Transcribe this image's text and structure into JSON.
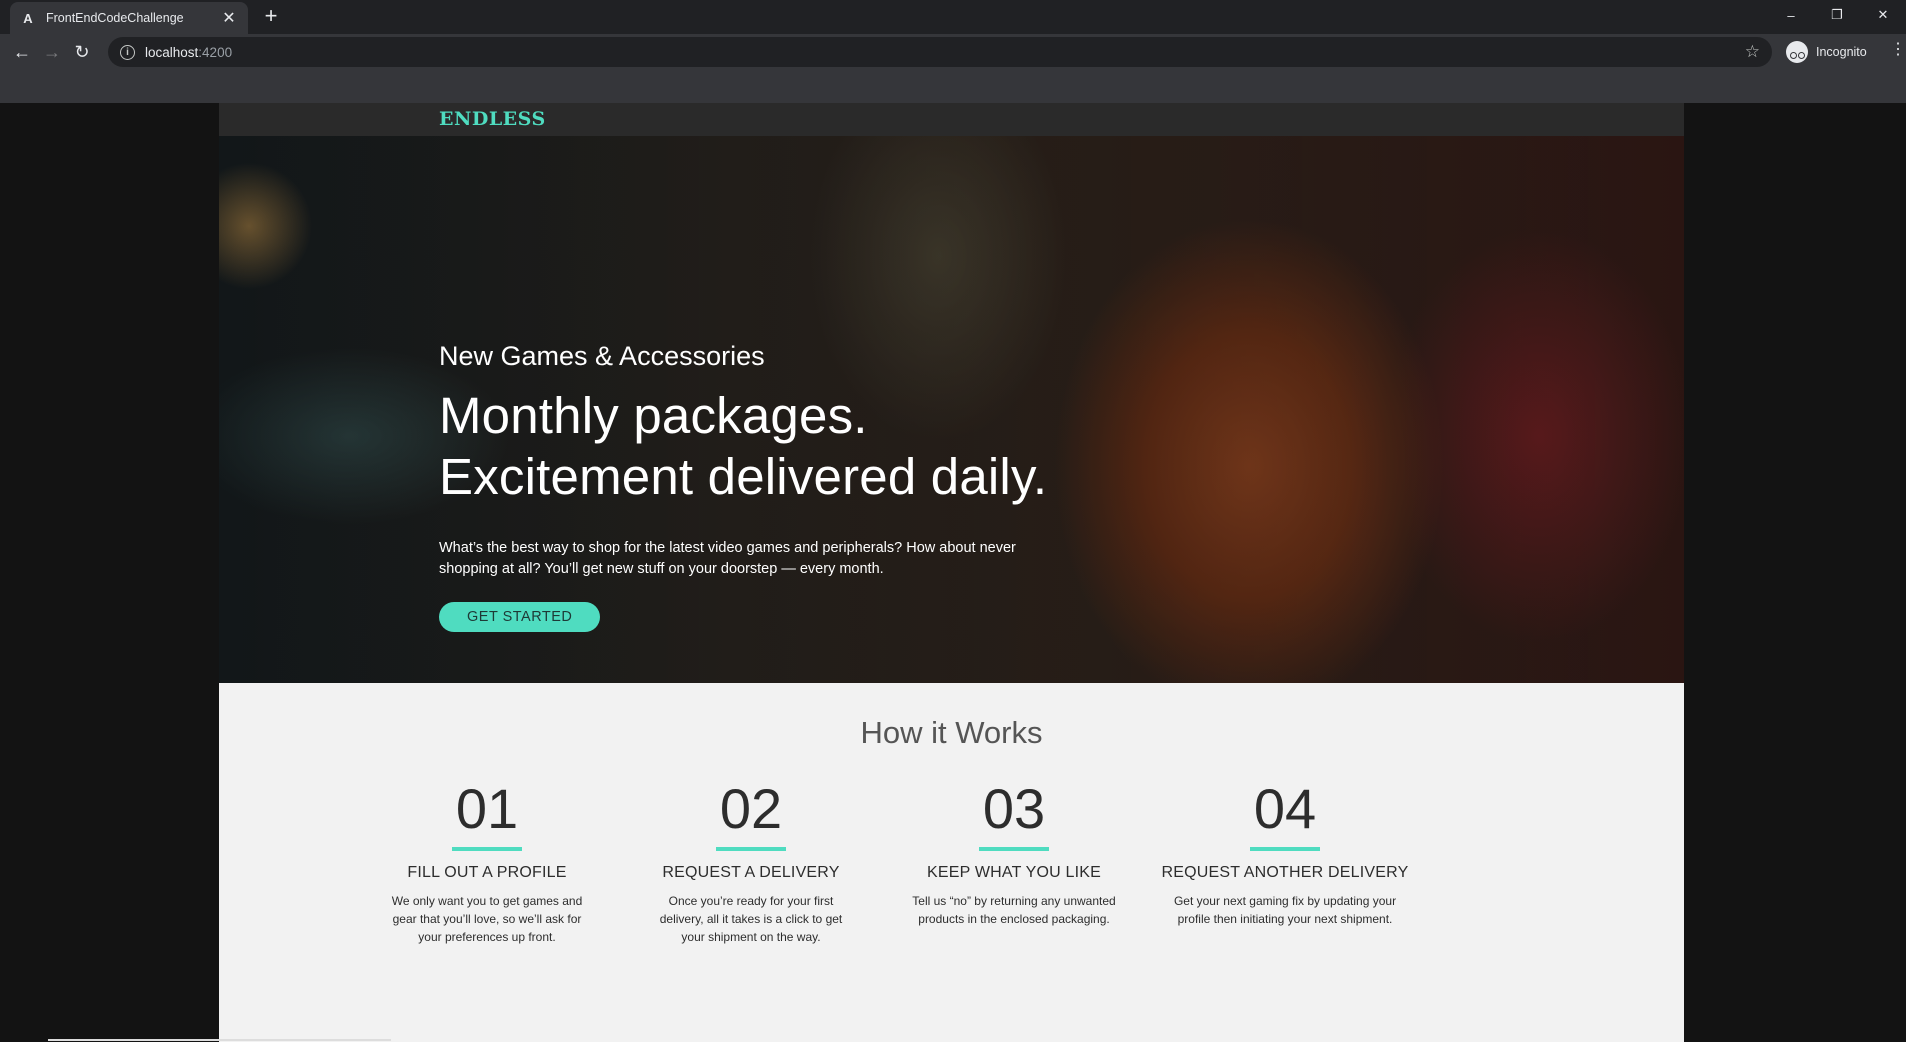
{
  "browser": {
    "tab_title": "FrontEndCodeChallenge",
    "tab_favicon": "A",
    "tab_close": "✕",
    "new_tab": "+",
    "url_host": "localhost",
    "url_port": ":4200",
    "incognito_label": "Incognito",
    "window_controls": {
      "minimize": "–",
      "restore": "❐",
      "close": "✕"
    }
  },
  "site": {
    "logo": "ENDLESS",
    "hero": {
      "eyebrow": "New Games & Accessories",
      "title_line1": "Monthly packages.",
      "title_line2": "Excitement delivered daily.",
      "description": "What’s the best way to shop for the latest video games and peripherals? How about never shopping at all? You’ll get new stuff on your doorstep — every month.",
      "cta_label": "GET STARTED"
    },
    "how_it_works": {
      "title": "How it Works",
      "steps": [
        {
          "number": "01",
          "title": "FILL OUT A PROFILE",
          "text": "We only want you to get games and gear that you’ll love, so we’ll ask for your preferences up front."
        },
        {
          "number": "02",
          "title": "REQUEST A DELIVERY",
          "text": "Once you’re ready for your first delivery, all it takes is a click to get your shipment on the way."
        },
        {
          "number": "03",
          "title": "KEEP WHAT YOU LIKE",
          "text": "Tell us “no” by returning any unwanted products in the enclosed packaging."
        },
        {
          "number": "04",
          "title": "REQUEST ANOTHER DELIVERY",
          "text": "Get your next gaming fix by updating your profile then initiating your next shipment."
        }
      ]
    }
  },
  "colors": {
    "accent": "#4fdcc0",
    "header_bg": "#2a2a2a",
    "section_bg": "#f2f2f2"
  }
}
